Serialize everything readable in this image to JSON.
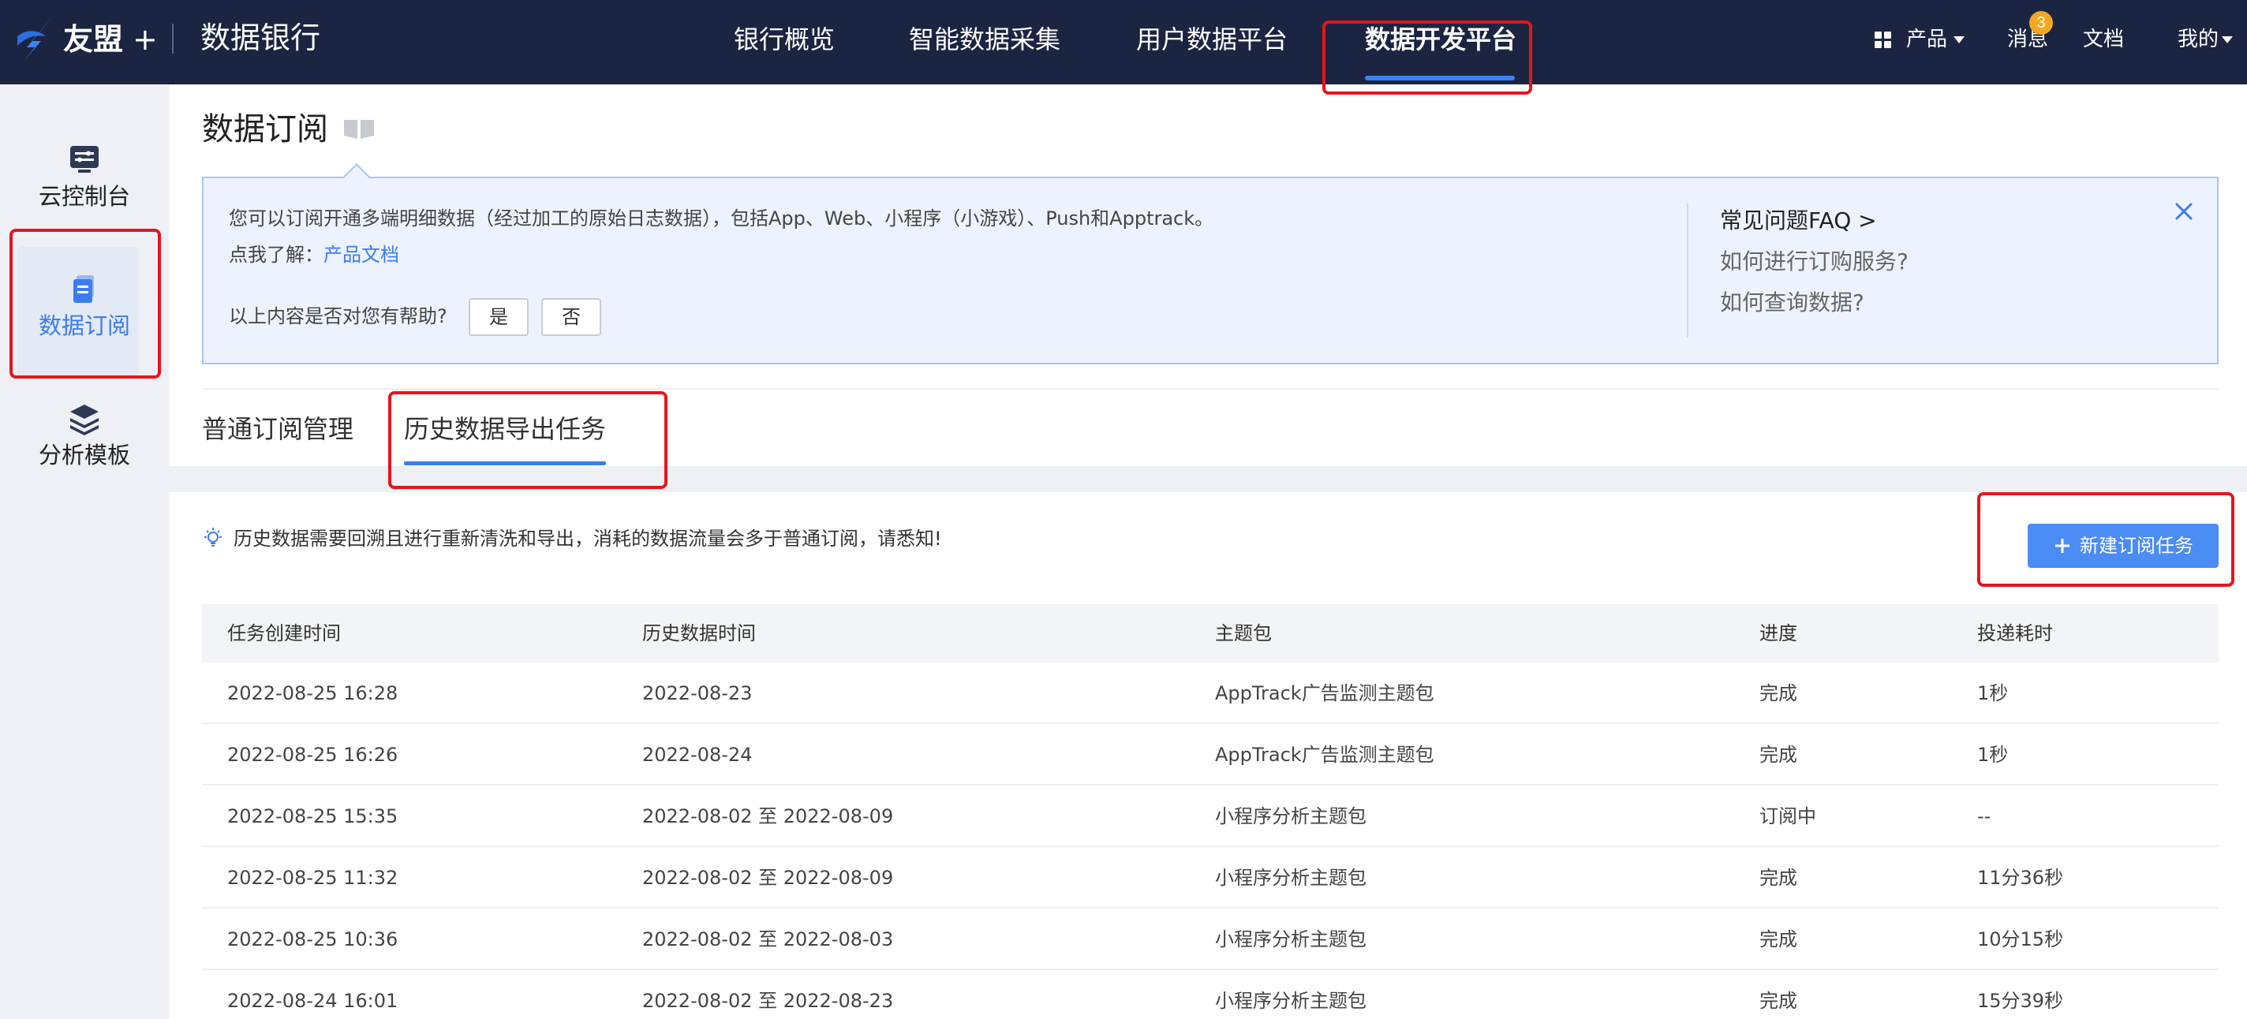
{
  "topbar": {
    "brand": "友盟",
    "brand_plus": "+",
    "app_title": "数据银行",
    "nav": [
      {
        "label": "银行概览",
        "active": false
      },
      {
        "label": "智能数据采集",
        "active": false
      },
      {
        "label": "用户数据平台",
        "active": false
      },
      {
        "label": "数据开发平台",
        "active": true
      }
    ],
    "products_label": "产品",
    "messages_label": "消息",
    "messages_count": "3",
    "docs_label": "文档",
    "me_label": "我的"
  },
  "sidebar": {
    "items": [
      {
        "label": "云控制台",
        "icon": "console-icon",
        "active": false
      },
      {
        "label": "数据订阅",
        "icon": "document-icon",
        "active": true
      },
      {
        "label": "分析模板",
        "icon": "layers-icon",
        "active": false
      }
    ]
  },
  "page": {
    "title": "数据订阅",
    "notice": {
      "line1": "您可以订阅开通多端明细数据（经过加工的原始日志数据），包括App、Web、小程序（小游戏）、Push和Apptrack。",
      "line2_prefix": "点我了解：",
      "line2_link": "产品文档",
      "helpful_question": "以上内容是否对您有帮助?",
      "yes_label": "是",
      "no_label": "否",
      "faq_title": "常见问题FAQ >",
      "faq_items": [
        "如何进行订购服务?",
        "如何查询数据?"
      ]
    },
    "tabs": [
      {
        "label": "普通订阅管理",
        "active": false
      },
      {
        "label": "历史数据导出任务",
        "active": true
      }
    ],
    "tip": "历史数据需要回溯且进行重新清洗和导出，消耗的数据流量会多于普通订阅，请悉知!",
    "new_task_label": "新建订阅任务",
    "table": {
      "headers": [
        "任务创建时间",
        "历史数据时间",
        "主题包",
        "进度",
        "投递耗时"
      ],
      "rows": [
        [
          "2022-08-25 16:28",
          "2022-08-23",
          "AppTrack广告监测主题包",
          "完成",
          "1秒"
        ],
        [
          "2022-08-25 16:26",
          "2022-08-24",
          "AppTrack广告监测主题包",
          "完成",
          "1秒"
        ],
        [
          "2022-08-25 15:35",
          "2022-08-02 至 2022-08-09",
          "小程序分析主题包",
          "订阅中",
          "--"
        ],
        [
          "2022-08-25 11:32",
          "2022-08-02 至 2022-08-09",
          "小程序分析主题包",
          "完成",
          "11分36秒"
        ],
        [
          "2022-08-25 10:36",
          "2022-08-02 至 2022-08-03",
          "小程序分析主题包",
          "完成",
          "10分15秒"
        ],
        [
          "2022-08-24 16:01",
          "2022-08-02 至 2022-08-23",
          "小程序分析主题包",
          "完成",
          "15分39秒"
        ]
      ]
    }
  },
  "colors": {
    "topbar_bg": "#1b2541",
    "accent": "#3b7cf0",
    "highlight_box": "#e8141c",
    "badge": "#f5a623"
  }
}
